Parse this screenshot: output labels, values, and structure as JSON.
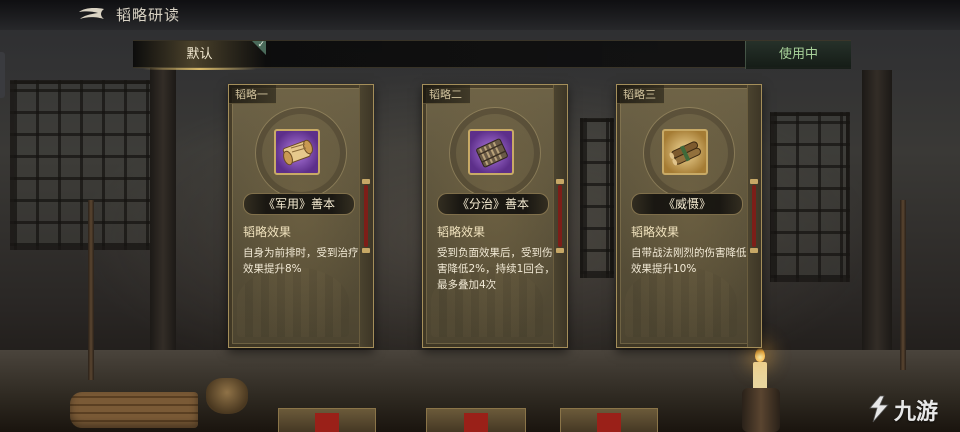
{
  "header": {
    "title": "韬略研读",
    "back_icon": "back-arrow-icon"
  },
  "tabs": {
    "default_label": "默认",
    "in_use_label": "使用中"
  },
  "colors": {
    "accent_gold": "#c8aa66",
    "in_use_green": "#a8d29a",
    "rarity_purple": "#5d2f8a",
    "rarity_gold": "#a57c34"
  },
  "cards": [
    {
      "slot": "韬略一",
      "name": "《军用》善本",
      "rarity": "purple",
      "icon": "scroll-item-icon",
      "effect_label": "韬略效果",
      "effect_text": "自身为前排时，受到治疗效果提升8%"
    },
    {
      "slot": "韬略二",
      "name": "《分治》善本",
      "rarity": "purple",
      "icon": "bamboo-slips-icon",
      "effect_label": "韬略效果",
      "effect_text": "受到负面效果后，受到伤害降低2%，持续1回合，最多叠加4次"
    },
    {
      "slot": "韬略三",
      "name": "《威慑》",
      "rarity": "gold",
      "icon": "scroll-bundle-icon",
      "effect_label": "韬略效果",
      "effect_text": "自带战法刚烈的伤害降低效果提升10%"
    }
  ],
  "watermark": {
    "text": "九游",
    "icon": "jiuyou-logo-icon"
  }
}
